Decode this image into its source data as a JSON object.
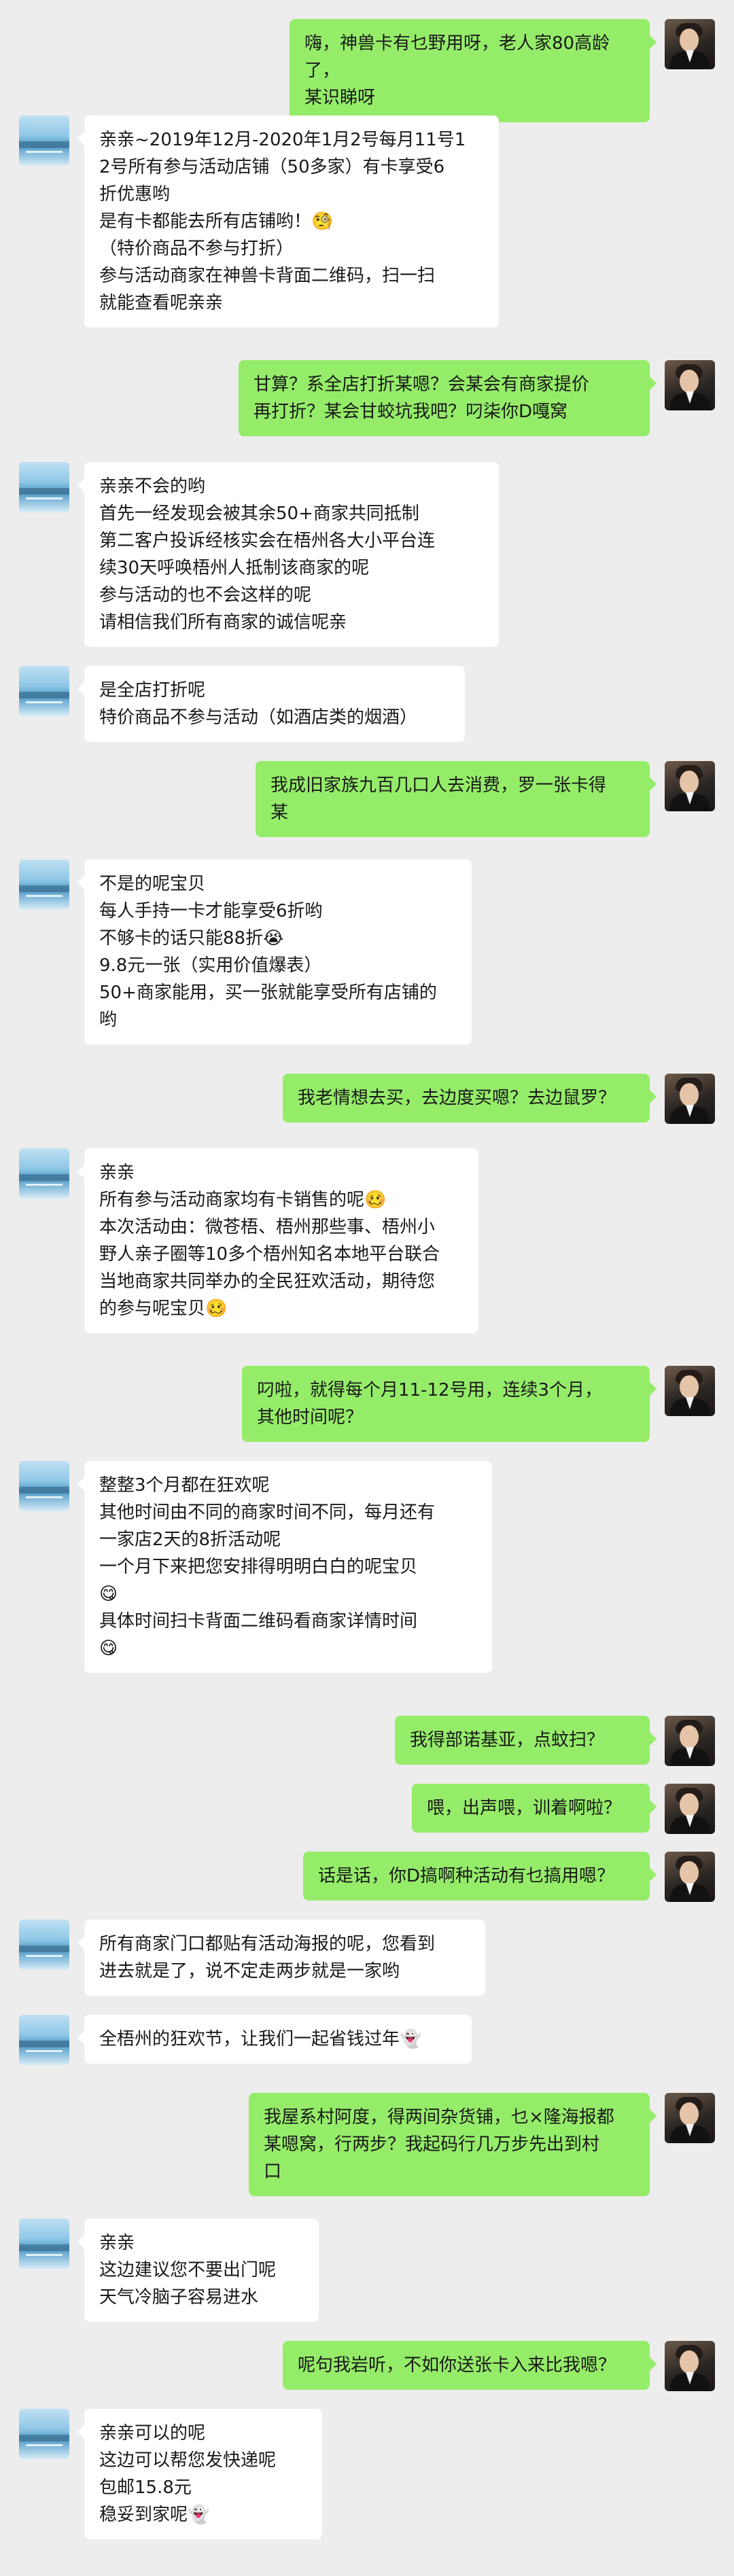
{
  "messages": [
    {
      "side": "right",
      "lines": [
        "嗨，神兽卡有乜野用呀，老人家80高龄了，",
        "某识睇呀"
      ]
    },
    {
      "side": "left",
      "lines": [
        "亲亲~2019年12月-2020年1月2号每月11号1",
        "2号所有参与活动店铺（50多家）有卡享受6",
        "折优惠哟",
        "是有卡都能去所有店铺哟！🧐",
        "（特价商品不参与打折）",
        "参与活动商家在神兽卡背面二维码，扫一扫",
        "就能查看呢亲亲"
      ]
    },
    {
      "side": "right",
      "lines": [
        "甘算？系全店打折某嗯？会某会有商家提价",
        "再打折？某会甘蛟坑我吧？叼柒你D嘎窝"
      ]
    },
    {
      "side": "left",
      "lines": [
        "亲亲不会的哟",
        "首先一经发现会被其余50+商家共同抵制",
        "第二客户投诉经核实会在梧州各大小平台连",
        "续30天呼唤梧州人抵制该商家的呢",
        "参与活动的也不会这样的呢",
        "请相信我们所有商家的诚信呢亲"
      ]
    },
    {
      "side": "left",
      "lines": [
        "是全店打折呢",
        "特价商品不参与活动（如酒店类的烟酒）"
      ]
    },
    {
      "side": "right",
      "lines": [
        "我成旧家族九百几口人去消费，罗一张卡得",
        "某"
      ]
    },
    {
      "side": "left",
      "lines": [
        "不是的呢宝贝",
        "每人手持一卡才能享受6折哟",
        "不够卡的话只能88折😭",
        "9.8元一张（实用价值爆表）",
        "50+商家能用，买一张就能享受所有店铺的",
        "哟"
      ]
    },
    {
      "side": "right",
      "lines": [
        "我老情想去买，去边度买嗯？去边鼠罗？"
      ]
    },
    {
      "side": "left",
      "lines": [
        "亲亲",
        "所有参与活动商家均有卡销售的呢🥴",
        "本次活动由：微苍梧、梧州那些事、梧州小",
        "野人亲子圈等10多个梧州知名本地平台联合",
        "当地商家共同举办的全民狂欢活动，期待您",
        "的参与呢宝贝🥴"
      ]
    },
    {
      "side": "right",
      "lines": [
        "叼啦，就得每个月11-12号用，连续3个月，",
        "其他时间呢？"
      ]
    },
    {
      "side": "left",
      "lines": [
        "整整3个月都在狂欢呢",
        "其他时间由不同的商家时间不同，每月还有",
        "一家店2天的8折活动呢",
        "一个月下来把您安排得明明白白的呢宝贝",
        "😋",
        "具体时间扫卡背面二维码看商家详情时间",
        "😋"
      ]
    },
    {
      "side": "right",
      "lines": [
        "我得部诺基亚，点蚊扫？"
      ]
    },
    {
      "side": "right",
      "lines": [
        "喂，出声喂，训着啊啦？"
      ]
    },
    {
      "side": "right",
      "lines": [
        "话是话，你D搞啊种活动有乜搞用嗯？"
      ]
    },
    {
      "side": "left",
      "lines": [
        "所有商家门口都贴有活动海报的呢，您看到",
        "进去就是了，说不定走两步就是一家哟"
      ]
    },
    {
      "side": "left",
      "lines": [
        "全梧州的狂欢节，让我们一起省钱过年👻"
      ]
    },
    {
      "side": "right",
      "lines": [
        "我屋系村阿度，得两间杂货铺，乜×隆海报都",
        "某嗯窝，行两步？我起码行几万步先出到村",
        "口"
      ]
    },
    {
      "side": "left",
      "lines": [
        "亲亲",
        "这边建议您不要出门呢",
        "天气冷脑子容易进水"
      ]
    },
    {
      "side": "right",
      "lines": [
        "呢句我岩听，不如你送张卡入来比我嗯？"
      ]
    },
    {
      "side": "left",
      "lines": [
        "亲亲可以的呢",
        "这边可以帮您发快递呢",
        "包邮15.8元",
        "稳妥到家呢👻"
      ]
    }
  ]
}
